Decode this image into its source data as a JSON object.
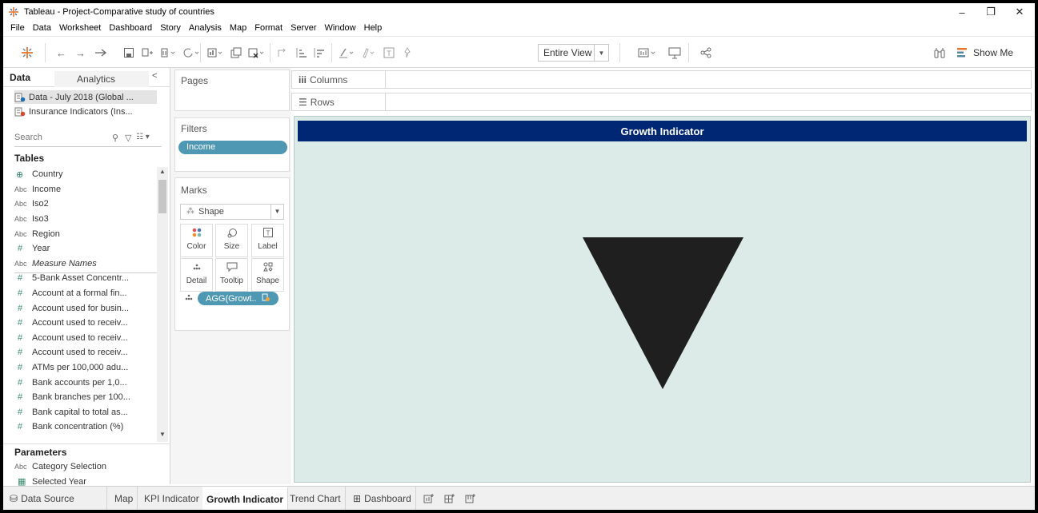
{
  "window": {
    "title": "Tableau - Project-Comparative study of countries",
    "controls": {
      "minimize": "–",
      "maximize": "❐",
      "close": "✕"
    }
  },
  "menu": [
    "File",
    "Data",
    "Worksheet",
    "Dashboard",
    "Story",
    "Analysis",
    "Map",
    "Format",
    "Server",
    "Window",
    "Help"
  ],
  "toolbar": {
    "fit": "Entire View",
    "show_me": "Show Me"
  },
  "data_pane": {
    "tab_data": "Data",
    "tab_analytics": "Analytics",
    "datasources": [
      "Data - July 2018 (Global ...",
      "Insurance Indicators (Ins..."
    ],
    "search_placeholder": "Search",
    "tables_title": "Tables",
    "fields": [
      {
        "type": "globe",
        "name": "Country"
      },
      {
        "type": "Abc",
        "name": "Income"
      },
      {
        "type": "Abc",
        "name": "Iso2"
      },
      {
        "type": "Abc",
        "name": "Iso3"
      },
      {
        "type": "Abc",
        "name": "Region"
      },
      {
        "type": "#",
        "name": "Year"
      },
      {
        "type": "Abc",
        "name": "Measure Names",
        "italic": true
      },
      {
        "type": "#",
        "name": "5-Bank Asset Concentr..."
      },
      {
        "type": "#",
        "name": "Account at a formal fin..."
      },
      {
        "type": "#",
        "name": "Account used for busin..."
      },
      {
        "type": "#",
        "name": "Account used to receiv..."
      },
      {
        "type": "#",
        "name": "Account used to receiv..."
      },
      {
        "type": "#",
        "name": "Account used to receiv..."
      },
      {
        "type": "#",
        "name": "ATMs per 100,000 adu..."
      },
      {
        "type": "#",
        "name": "Bank accounts per 1,0..."
      },
      {
        "type": "#",
        "name": "Bank branches per 100..."
      },
      {
        "type": "#",
        "name": "Bank capital to total as..."
      },
      {
        "type": "#",
        "name": "Bank concentration (%)"
      }
    ],
    "parameters_title": "Parameters",
    "parameters": [
      {
        "type": "Abc",
        "name": "Category Selection"
      },
      {
        "type": "cal",
        "name": "Selected Year"
      }
    ]
  },
  "shelves": {
    "pages": "Pages",
    "filters": "Filters",
    "filter_pill": "Income",
    "marks": "Marks",
    "mark_type": "Shape",
    "mark_buttons": [
      "Color",
      "Size",
      "Label",
      "Detail",
      "Tooltip",
      "Shape"
    ],
    "agg_pill": "AGG(Growt.."
  },
  "columns_label": "Columns",
  "rows_label": "Rows",
  "viz": {
    "title": "Growth Indicator",
    "background": "#dcebe8",
    "title_bar_color": "#002774",
    "mark_shape": "down-triangle",
    "mark_color": "#1f1f1f"
  },
  "sheet_tabs": {
    "data_source": "Data Source",
    "tabs": [
      "Map",
      "KPI Indicator",
      "Growth Indicator",
      "Trend Chart",
      "Dashboard"
    ],
    "active": "Growth Indicator"
  }
}
